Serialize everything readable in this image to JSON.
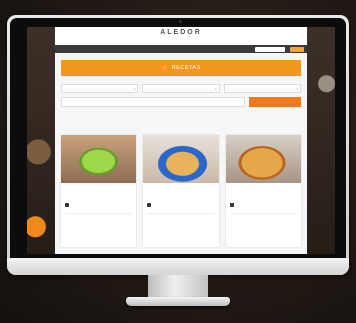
{
  "site": {
    "logo": "ALEDOR",
    "tagline": "",
    "nav": [
      "",
      "",
      "",
      "",
      "",
      "",
      "",
      ""
    ]
  },
  "hero": {
    "icon": "utensils-icon",
    "title": "RECETAS"
  },
  "filters": {
    "category_placeholder": "",
    "difficulty_placeholder": "",
    "time_placeholder": "",
    "keyword_placeholder": "",
    "search_button": ""
  },
  "cards": [
    {
      "title": "",
      "author": "",
      "meta_label": "",
      "meta_value": ""
    },
    {
      "title": "",
      "author": "",
      "meta_label": "",
      "meta_value": ""
    },
    {
      "title": "",
      "author": "",
      "meta_label": "",
      "meta_value": ""
    }
  ],
  "colors": {
    "accent": "#f2981f",
    "nav_bg": "#3a3a3a",
    "button": "#f27a1a"
  }
}
